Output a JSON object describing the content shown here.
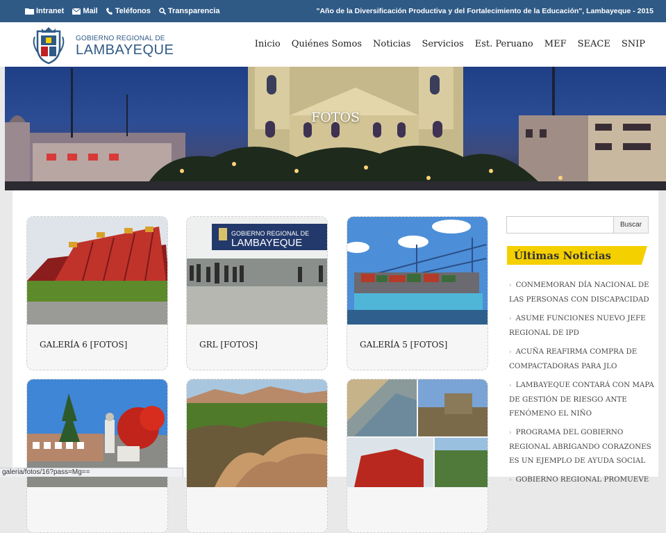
{
  "topbar": {
    "links": [
      {
        "label": "Intranet",
        "icon": "folder-icon"
      },
      {
        "label": "Mail",
        "icon": "envelope-icon"
      },
      {
        "label": "Teléfonos",
        "icon": "phone-icon"
      },
      {
        "label": "Transparencia",
        "icon": "search-icon"
      }
    ],
    "motto": "\"Año de la Diversificación Productiva y del Fortalecimiento de la Educación\", Lambayeque - 2015"
  },
  "header": {
    "brand_small": "GOBIERNO REGIONAL DE",
    "brand_big": "LAMBAYEQUE",
    "nav": [
      "Inicio",
      "Quiénes Somos",
      "Noticias",
      "Servicios",
      "Est. Peruano",
      "MEF",
      "SEACE",
      "SNIP"
    ]
  },
  "hero": {
    "title": "FOTOS"
  },
  "gallery": [
    {
      "caption": "GALERÍA 6 [FOTOS]"
    },
    {
      "caption": "GRL [FOTOS]"
    },
    {
      "caption": "GALERÍA 5 [FOTOS]"
    },
    {
      "caption": ""
    },
    {
      "caption": ""
    },
    {
      "caption": ""
    }
  ],
  "sidebar": {
    "search_button": "Buscar",
    "news_title": "Últimas Noticias",
    "news": [
      "CONMEMORAN DÍA NACIONAL DE LAS PERSONAS CON DISCAPACIDAD",
      "ASUME FUNCIONES NUEVO JEFE REGIONAL DE IPD",
      "ACUÑA REAFIRMA COMPRA DE COMPACTADORAS PARA JLO",
      "LAMBAYEQUE CONTARÁ CON MAPA DE GESTIÓN DE RIESGO ANTE FENÓMENO EL NIÑO",
      "PROGRAMA DEL GOBIERNO REGIONAL ABRIGANDO CORAZONES ES UN EJEMPLO DE AYUDA SOCIAL",
      "GOBIERNO REGIONAL PROMUEVE"
    ]
  },
  "statusbar": {
    "url": "galeria/fotos/16?pass=Mg=="
  },
  "colors": {
    "topbar": "#2f5a86",
    "accent": "#f5d000"
  }
}
